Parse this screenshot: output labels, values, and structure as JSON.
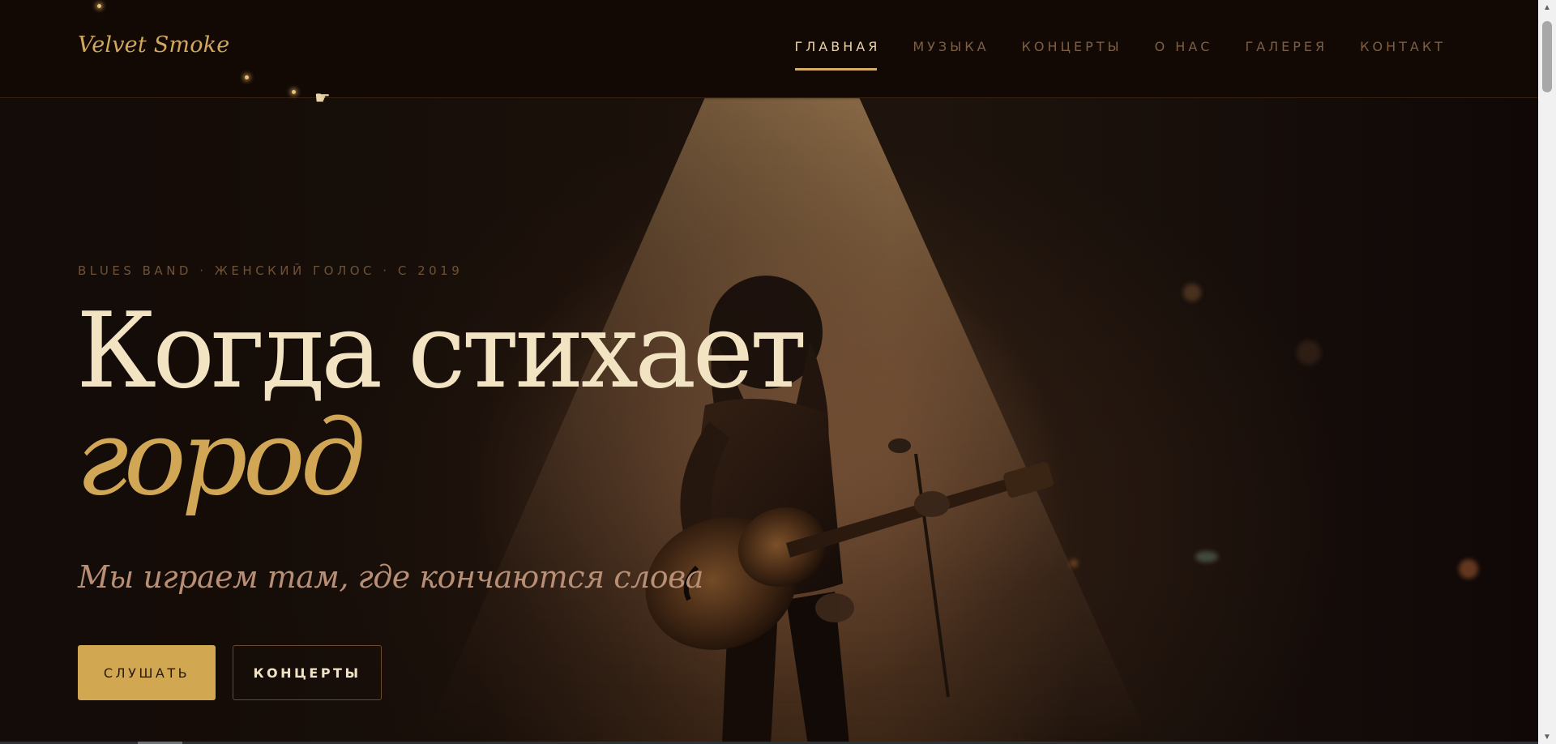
{
  "logo": "Velvet Smoke",
  "nav": [
    {
      "label": "ГЛАВНАЯ",
      "active": true
    },
    {
      "label": "МУЗЫКА",
      "active": false
    },
    {
      "label": "КОНЦЕРТЫ",
      "active": false
    },
    {
      "label": "О НАС",
      "active": false
    },
    {
      "label": "ГАЛЕРЕЯ",
      "active": false
    },
    {
      "label": "КОНТАКТ",
      "active": false
    }
  ],
  "hero": {
    "eyebrow": "BLUES BAND · ЖЕНСКИЙ ГОЛОС · С 2019",
    "title_line1": "Когда стихает",
    "title_line2": "город",
    "subtitle": "Мы играем там, где кончаются слова",
    "primary_button": "СЛУШАТЬ",
    "secondary_button": "КОНЦЕРТЫ"
  },
  "colors": {
    "accent": "#d2a752",
    "background": "#130b07",
    "title": "#f2e3c3",
    "subtitle": "#b88e74"
  },
  "icons": {
    "cursor": "pointing-hand-icon"
  }
}
